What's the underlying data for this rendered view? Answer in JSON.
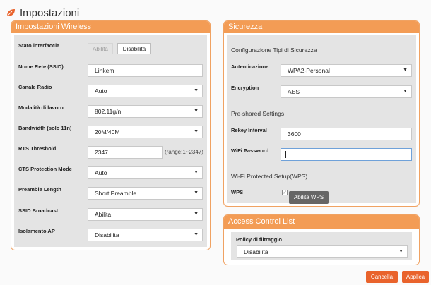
{
  "page": {
    "title": "Impostazioni",
    "icon": "leaf-icon",
    "accent_color": "#f39c55"
  },
  "wireless": {
    "title": "Impostazioni Wireless",
    "stato_interfaccia": {
      "label": "Stato interfaccia",
      "option_on": "Abilita",
      "option_off": "Disabilita",
      "selected": "Disabilita"
    },
    "ssid": {
      "label": "Nome Rete (SSID)",
      "value": "Linkem"
    },
    "canale": {
      "label": "Canale Radio",
      "value": "Auto"
    },
    "modalita": {
      "label": "Modalità di lavoro",
      "value": "802.11g/n"
    },
    "bandwidth": {
      "label": "Bandwidth (solo 11n)",
      "value": "20M/40M"
    },
    "rts": {
      "label": "RTS Threshold",
      "value": "2347",
      "range": "(range:1~2347)"
    },
    "cts": {
      "label": "CTS Protection Mode",
      "value": "Auto"
    },
    "preamble": {
      "label": "Preamble Length",
      "value": "Short Preamble"
    },
    "ssid_broadcast": {
      "label": "SSID Broadcast",
      "value": "Abilita"
    },
    "isolamento": {
      "label": "Isolamento AP",
      "value": "Disabilita"
    }
  },
  "sicurezza": {
    "title": "Sicurezza",
    "config_title": "Configurazione Tipi di Sicurezza",
    "autenticazione": {
      "label": "Autenticazione",
      "value": "WPA2-Personal"
    },
    "encryption": {
      "label": "Encryption",
      "value": "AES"
    },
    "preshared_title": "Pre-shared Settings",
    "rekey": {
      "label": "Rekey Interval",
      "value": "3600"
    },
    "password": {
      "label": "WiFi Password",
      "value": ""
    },
    "wps_title": "Wi-Fi Protected Setup(WPS)",
    "wps": {
      "label": "WPS",
      "checked": true,
      "button": "Abilita WPS"
    }
  },
  "acl": {
    "title": "Access Control List",
    "policy": {
      "label": "Policy di filtraggio",
      "value": "Disabilita"
    }
  },
  "footer": {
    "cancel": "Cancella",
    "apply": "Applica"
  }
}
